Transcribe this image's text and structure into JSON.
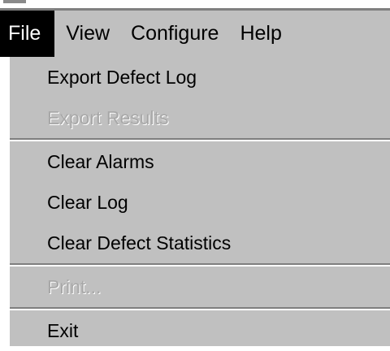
{
  "menubar": {
    "menus": [
      {
        "label": "File",
        "active": true
      },
      {
        "label": "View",
        "active": false
      },
      {
        "label": "Configure",
        "active": false
      },
      {
        "label": "Help",
        "active": false
      }
    ]
  },
  "file_menu": {
    "items": [
      {
        "label": "Export Defect Log",
        "enabled": true
      },
      {
        "label": "Export Results",
        "enabled": false
      },
      {
        "label": "Clear Alarms",
        "enabled": true
      },
      {
        "label": "Clear Log",
        "enabled": true
      },
      {
        "label": "Clear Defect Statistics",
        "enabled": true
      },
      {
        "label": "Print...",
        "enabled": false
      },
      {
        "label": "Exit",
        "enabled": true
      }
    ]
  },
  "colors": {
    "menu_background": "#c0c0c0",
    "active_menu_background": "#000000",
    "active_menu_text": "#ffffff",
    "disabled_text": "#a8a8a8"
  }
}
